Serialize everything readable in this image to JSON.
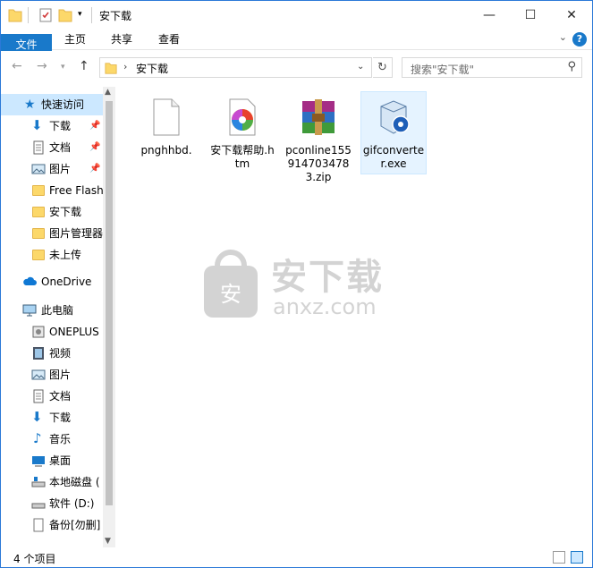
{
  "window": {
    "title": "安下载",
    "controls": [
      "—",
      "☐",
      "✕"
    ]
  },
  "ribbon": {
    "tabs": [
      "文件",
      "主页",
      "共享",
      "查看"
    ],
    "help": "?"
  },
  "address": {
    "crumb": "安下载",
    "refresh": "↻",
    "search_placeholder": "搜索\"安下载\""
  },
  "sidebar": {
    "items": [
      {
        "label": "快速访问",
        "icon": "star-icon",
        "pinned": false
      },
      {
        "label": "下载",
        "icon": "download-icon",
        "pinned": true
      },
      {
        "label": "文档",
        "icon": "document-icon",
        "pinned": true
      },
      {
        "label": "图片",
        "icon": "pictures-icon",
        "pinned": true
      },
      {
        "label": "Free Flash",
        "icon": "folder-icon",
        "pinned": false
      },
      {
        "label": "安下载",
        "icon": "folder-icon",
        "pinned": false
      },
      {
        "label": "图片管理器",
        "icon": "folder-icon",
        "pinned": false
      },
      {
        "label": "未上传",
        "icon": "folder-icon",
        "pinned": false
      },
      {
        "label": "OneDrive",
        "icon": "cloud-icon",
        "pinned": false
      },
      {
        "label": "此电脑",
        "icon": "computer-icon",
        "pinned": false
      },
      {
        "label": "ONEPLUS",
        "icon": "device-icon",
        "pinned": false
      },
      {
        "label": "视频",
        "icon": "video-icon",
        "pinned": false
      },
      {
        "label": "图片",
        "icon": "pictures-icon",
        "pinned": false
      },
      {
        "label": "文档",
        "icon": "document-icon",
        "pinned": false
      },
      {
        "label": "下载",
        "icon": "download-icon",
        "pinned": false
      },
      {
        "label": "音乐",
        "icon": "music-icon",
        "pinned": false
      },
      {
        "label": "桌面",
        "icon": "desktop-icon",
        "pinned": false
      },
      {
        "label": "本地磁盘 (",
        "icon": "drive-icon",
        "pinned": false
      },
      {
        "label": "软件 (D:)",
        "icon": "drive-icon",
        "pinned": false
      },
      {
        "label": "备份[勿删]",
        "icon": "drive-icon",
        "pinned": false
      }
    ]
  },
  "files": [
    {
      "name": "pnghhbd.",
      "icon": "blank-file-icon",
      "selected": false
    },
    {
      "name": "安下载帮助.htm",
      "icon": "htm-file-icon",
      "selected": false
    },
    {
      "name": "pconline1559147034783.zip",
      "icon": "winrar-archive-icon",
      "selected": false
    },
    {
      "name": "gifconverter.exe",
      "icon": "installer-exe-icon",
      "selected": true
    }
  ],
  "watermark": {
    "text": "安下载",
    "subtext": "anxz.com"
  },
  "status": {
    "count": "4 个项目"
  },
  "colors": {
    "accent": "#1979ca",
    "selection": "#cce8ff",
    "folder": "#fcd86a"
  }
}
